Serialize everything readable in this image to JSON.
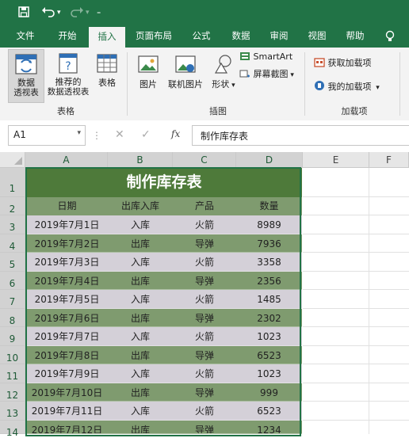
{
  "quick_access": {
    "save_icon": "save-icon",
    "undo_icon": "undo-icon",
    "redo_icon": "redo-icon",
    "customize_icon": "customize-icon"
  },
  "tabs": [
    "文件",
    "开始",
    "插入",
    "页面布局",
    "公式",
    "数据",
    "审阅",
    "视图",
    "帮助"
  ],
  "active_tab": "插入",
  "ribbon": {
    "pivot": [
      "数据",
      "透视表"
    ],
    "recommended_pivot": [
      "推荐的",
      "数据透视表"
    ],
    "table": "表格",
    "group_tables": "表格",
    "picture": "图片",
    "online_picture": "联机图片",
    "shapes": "形状",
    "smartart": "SmartArt",
    "screenshot": "屏幕截图",
    "group_illustrations": "插图",
    "get_addins": "获取加载项",
    "my_addins": "我的加载项",
    "group_addins": "加载项"
  },
  "formula_bar": {
    "name_box": "A1",
    "fx": "fx",
    "content": "制作库存表"
  },
  "sheet": {
    "columns": [
      "A",
      "B",
      "C",
      "D",
      "E",
      "F"
    ],
    "row_numbers": [
      "1",
      "2",
      "3",
      "4",
      "5",
      "6",
      "7",
      "8",
      "9",
      "10",
      "11",
      "12",
      "13",
      "14"
    ],
    "title": "制作库存表",
    "headers": [
      "日期",
      "出库入库",
      "产品",
      "数量"
    ],
    "rows": [
      [
        "2019年7月1日",
        "入库",
        "火箭",
        "8989"
      ],
      [
        "2019年7月2日",
        "出库",
        "导弹",
        "7936"
      ],
      [
        "2019年7月3日",
        "入库",
        "火箭",
        "3358"
      ],
      [
        "2019年7月4日",
        "出库",
        "导弹",
        "2356"
      ],
      [
        "2019年7月5日",
        "入库",
        "火箭",
        "1485"
      ],
      [
        "2019年7月6日",
        "出库",
        "导弹",
        "2302"
      ],
      [
        "2019年7月7日",
        "入库",
        "火箭",
        "1023"
      ],
      [
        "2019年7月8日",
        "出库",
        "导弹",
        "6523"
      ],
      [
        "2019年7月9日",
        "入库",
        "火箭",
        "1023"
      ],
      [
        "2019年7月10日",
        "出库",
        "导弹",
        "999"
      ],
      [
        "2019年7月11日",
        "入库",
        "火箭",
        "6523"
      ],
      [
        "2019年7月12日",
        "出库",
        "导弹",
        "1234"
      ]
    ]
  },
  "colors": {
    "excel_green": "#217346",
    "title_fill": "#4e7a3a",
    "band_green": "#7f9b6f",
    "band_light": "#d4d0d8"
  }
}
